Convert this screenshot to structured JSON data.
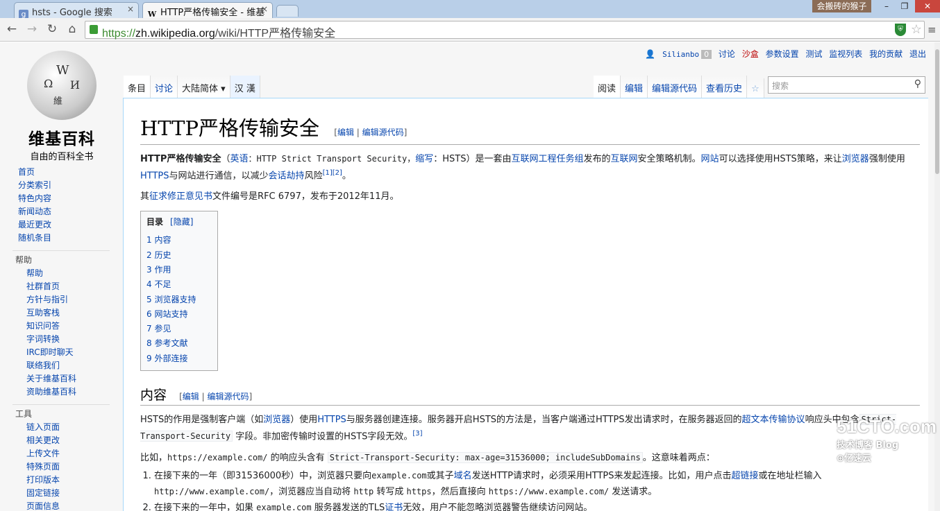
{
  "browser": {
    "tabs": [
      {
        "favicon": "g",
        "title": "hsts - Google 搜索",
        "close": "×"
      },
      {
        "favicon": "W",
        "title": "HTTP严格传输安全 - 维基",
        "close": "×"
      }
    ],
    "window_user": "会搬砖的猴子",
    "window_buttons": {
      "minimize": "–",
      "maximize": "❐",
      "close": "✕"
    },
    "nav": {
      "back": "←",
      "forward": "→",
      "reload": "↻",
      "home": "⌂",
      "menu": "≡"
    },
    "url": {
      "proto": "https://",
      "host": "zh.wikipedia.org",
      "path": "/wiki/HTTP严格传输安全"
    },
    "shield_text": "⛨",
    "bookmark_star": "☆"
  },
  "wiki": {
    "logo": {
      "name": "维基百科",
      "tagline": "自由的百科全书"
    },
    "personal": {
      "user": "Silianbo",
      "notifications": "0",
      "links": [
        "讨论",
        "沙盒",
        "参数设置",
        "测试",
        "监视列表",
        "我的贡献",
        "退出"
      ]
    },
    "left_tabs": [
      "条目",
      "讨论",
      "大陆简体 ▾",
      "汉  漢"
    ],
    "right_tabs": [
      "阅读",
      "编辑",
      "编辑源代码",
      "查看历史",
      "☆"
    ],
    "search_placeholder": "搜索",
    "search_icon": "⚲",
    "sidebar": {
      "main": [
        "首页",
        "分类索引",
        "特色内容",
        "新闻动态",
        "最近更改",
        "随机条目"
      ],
      "help_title": "帮助",
      "help": [
        "帮助",
        "社群首页",
        "方针与指引",
        "互助客栈",
        "知识问答",
        "字词转换",
        "IRC即时聊天",
        "联络我们",
        "关于维基百科",
        "资助维基百科"
      ],
      "tools_title": "工具",
      "tools": [
        "链入页面",
        "相关更改",
        "上传文件",
        "特殊页面",
        "打印版本",
        "固定链接",
        "页面信息"
      ]
    },
    "article": {
      "title": "HTTP严格传输安全",
      "edit_links": {
        "open": "[",
        "edit": "编辑",
        "sep": " | ",
        "edit_source": "编辑源代码",
        "close": "]"
      },
      "intro1": {
        "bold": "HTTP严格传输安全",
        "t1": "（",
        "l1": "英语",
        "t2": "：HTTP Strict Transport Security，",
        "l2": "缩写",
        "t3": "：HSTS）是一套由",
        "l3": "互联网工程任务组",
        "t4": "发布的",
        "l4": "互联网",
        "t5": "安全策略机制。",
        "l5": "网站",
        "t6": "可以选择使用HSTS策略，来让",
        "l6": "浏览器",
        "t7": "强制使用",
        "l7": "HTTPS",
        "t8": "与网站进行通信，以减少",
        "l8": "会话劫持",
        "t9": "风险",
        "refs": "[1][2]",
        "t10": "。"
      },
      "intro2": {
        "t1": "其",
        "l1": "征求修正意见书",
        "t2": "文件编号是RFC 6797，发布于2012年11月。"
      },
      "toc": {
        "title": "目录",
        "toggle": "[隐藏]",
        "items": [
          "1 内容",
          "2 历史",
          "3 作用",
          "4 不足",
          "5 浏览器支持",
          "6 网站支持",
          "7 参见",
          "8 参考文献",
          "9 外部连接"
        ]
      },
      "section1": {
        "heading": "内容",
        "p1": {
          "t1": "HSTS的作用是强制客户端（如",
          "l1": "浏览器",
          "t2": "）使用",
          "l2": "HTTPS",
          "t3": "与服务器创建连接。服务器开启HSTS的方法是，当客户端通过HTTPS发出请求时，在服务器返回的",
          "l3": "超文本传输协议",
          "t4": "响应头中包含",
          "code": "Strict-Transport-Security",
          "t5": " 字段。非加密传输时设置的HSTS字段无效。",
          "ref": "[3]"
        },
        "p2": {
          "t1": "比如，",
          "m1": "https://example.com/",
          "t2": " 的响应头含有 ",
          "code": "Strict-Transport-Security: max-age=31536000; includeSubDomains",
          "t3": "。这意味着两点："
        },
        "list": [
          {
            "t1": "在接下来的一年（即31536000秒）中，浏览器只要向",
            "m1": "example.com",
            "t2": "或其子",
            "l1": "域名",
            "t3": "发送HTTP请求时，必须采用HTTPS来发起连接。比如，用户点击",
            "l2": "超链接",
            "t4": "或在地址栏输入",
            "m2": "http://www.example.com/",
            "t5": "，浏览器应当自动将 ",
            "m3": "http",
            "t6": " 转写成 ",
            "m4": "https",
            "t7": "，然后直接向 ",
            "m5": "https://www.example.com/",
            "t8": " 发送请求。"
          },
          {
            "t1": "在接下来的一年中，如果 ",
            "m1": "example.com",
            "t2": " 服务器发送的TLS",
            "l1": "证书",
            "t3": "无效，用户不能忽略浏览器警告继续访问网站。"
          }
        ]
      }
    }
  },
  "watermark": {
    "big": "51CTO.com",
    "small": "技术博客  Blog",
    "brand": "⊕亿速云"
  }
}
